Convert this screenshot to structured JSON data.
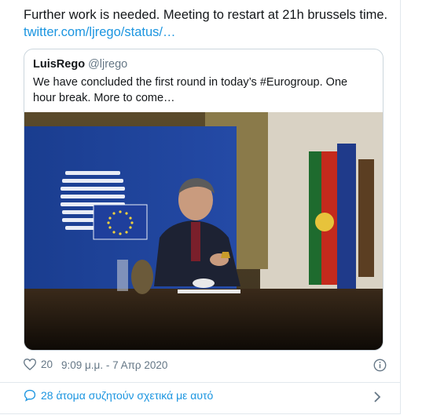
{
  "tweet": {
    "text": "Further work is needed. Meeting to restart at 21h brussels time.",
    "link": "twitter.com/ljrego/status/…"
  },
  "quote": {
    "name": "LuisRego",
    "handle": "@ljrego",
    "text": "We have concluded the first round in today’s #Eurogroup. One hour break. More to come…"
  },
  "footer": {
    "likes": "20",
    "timestamp": "9:09 μ.μ. - 7 Απρ 2020",
    "conversation": "28 άτομα συζητούν σχετικά με αυτό"
  },
  "icons": {
    "like": "heart-icon",
    "info": "info-icon",
    "conversation": "speech-bubble-icon",
    "chevron": "chevron-right-icon"
  },
  "colors": {
    "link": "#1b95e0",
    "muted": "#657786",
    "border": "#ccd6dd"
  }
}
